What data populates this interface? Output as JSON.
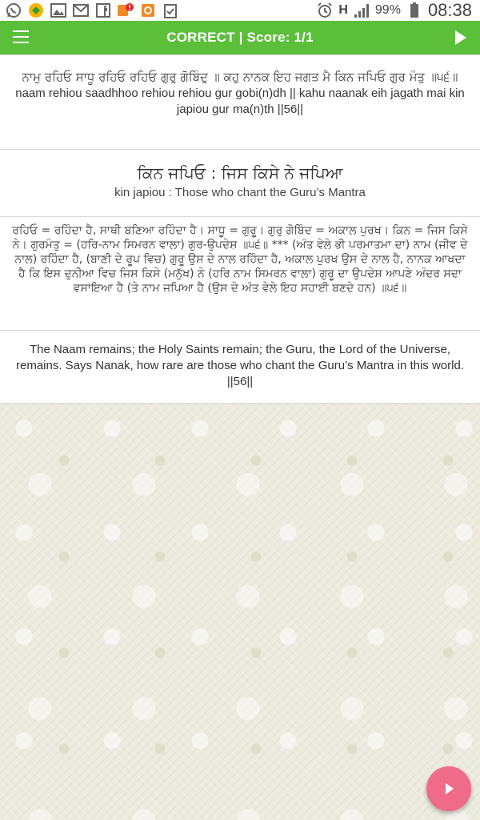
{
  "status_bar": {
    "notification_icons": [
      "whatsapp-icon",
      "puzzle-app-icon",
      "gallery-icon",
      "gmail-icon",
      "facebook-icon",
      "quikr-alert-icon",
      "quikr-icon",
      "clipboard-check-icon"
    ],
    "network_type": "H",
    "battery_percent": "99%",
    "time": "08:38"
  },
  "app_bar": {
    "title": "CORRECT | Score: 1/1",
    "color": "#5bbf3a"
  },
  "verse": {
    "gurmukhi": "ਨਾਮੁ ਰਹਿਓ ਸਾਧੂ ਰਹਿਓ ਰਹਿਓ ਗੁਰੁ ਗੋਬਿੰਦੁ ॥ ਕਹੁ ਨਾਨਕ ਇਹ ਜਗਤ ਮੈ ਕਿਨ ਜਪਿਓ ਗੁਰ ਮੰਤੁ ॥੫੬॥",
    "transliteration": "naam rehiou saadhhoo rehiou rehiou gur gobi(n)dh || kahu naanak eih jagath mai kin japiou gur ma(n)th ||56||"
  },
  "word": {
    "gurmukhi": "ਕਿਨ ਜਪਿਓ : ਜਿਸ ਕਿਸੇ ਨੇ ਜਪਿਆ",
    "transliteration": "kin japiou : Those who chant the Guru’s Mantra"
  },
  "meaning": {
    "gurmukhi": "ਰਹਿਓ = ਰਹਿੰਦਾ ਹੈ, ਸਾਥੀ ਬਣਿਆ ਰਹਿੰਦਾ ਹੈ। ਸਾਧੂ = ਗੁਰੂ। ਗੁਰੁ ਗੋਬਿੰਦ = ਅਕਾਲ ਪੁਰਖ। ਕਿਨ = ਜਿਸ ਕਿਸੇ ਨੇ। ਗੁਰਮੰਤੁ = (ਹਰਿ-ਨਾਮ ਸਿਮਰਨ ਵਾਲਾ) ਗੁਰ-ਉਪਦੇਸ਼ ॥੫੬॥ *** (ਅੰਤ ਵੇਲੇ ਭੀ ਪਰਮਾਤਮਾ ਦਾ) ਨਾਮ (ਜੀਵ ਦੇ ਨਾਲ) ਰਹਿੰਦਾ ਹੈ, (ਬਾਣੀ ਦੇ ਰੂਪ ਵਿਚ) ਗੁਰੂ ਉਸ ਦੇ ਨਾਲ ਰਹਿੰਦਾ ਹੈ, ਅਕਾਲ ਪੁਰਖ ਉਸ ਦੇ ਨਾਲ ਹੈ, ਨਾਨਕ ਆਖਦਾ ਹੈ ਕਿ ਇਸ ਦੁਨੀਆ ਵਿਚ ਜਿਸ ਕਿਸੇ (ਮਨੁੱਖ) ਨੇ (ਹਰਿ ਨਾਮ ਸਿਮਰਨ ਵਾਲਾ) ਗੁਰੂ ਦਾ ਉਪਦੇਸ਼ ਆਪਣੇ ਅੰਦਰ ਸਦਾ ਵਸਾਇਆ ਹੈ (ਤੇ ਨਾਮ ਜਪਿਆ ਹੈ (ਉਸ ਦੇ ਅੰਤ ਵੇਲੇ ਇਹ ਸਹਾਈ ਬਣਦੇ ਹਨ) ॥੫੬॥"
  },
  "english_translation": "The Naam remains; the Holy Saints remain; the Guru, the Lord of the Universe, remains. Says Nanak, how rare are those who chant the Guru’s Mantra in this world. ||56||",
  "fab": {
    "icon": "play-icon",
    "color": "#f06a8a"
  }
}
